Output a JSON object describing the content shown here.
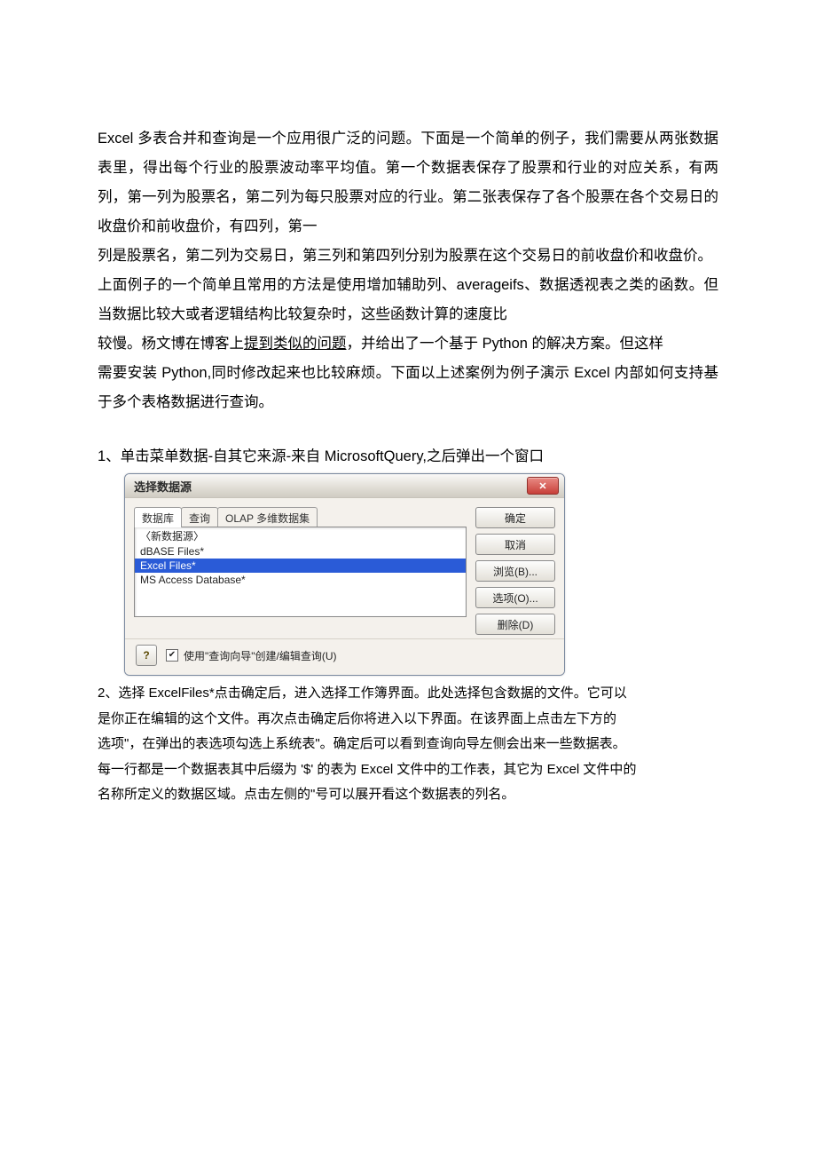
{
  "paragraphs": {
    "p1": "Excel 多表合并和查询是一个应用很广泛的问题。下面是一个简单的例子，我们需要从两张数据表里，得出每个行业的股票波动率平均值。第一个数据表保存了股票和行业的对应关系，有两列，第一列为股票名，第二列为每只股票对应的行业。第二张表保存了各个股票在各个交易日的收盘价和前收盘价，有四列，第一",
    "p2": "列是股票名，第二列为交易日，第三列和第四列分别为股票在这个交易日的前收盘价和收盘价。",
    "p3a": "上面例子的一个简单且常用的方法是使用增加辅助列、averageifs、数据透视表之类的函数。但当数据比较大或者逻辑结构比较复杂时，这些函数计算的速度比",
    "p3b_prefix": "较慢。杨文博在博客上",
    "p3b_link": "提到类似的问题",
    "p3b_suffix": "，并给出了一个基于 Python 的解决方案。但这样",
    "p3c": "需要安装 Python,同时修改起来也比较麻烦。下面以上述案例为例子演示 Excel 内部如何支持基于多个表格数据进行查询。"
  },
  "step1": "1、单击菜单数据-自其它来源-来自 MicrosoftQuery,之后弹出一个窗口",
  "dialog": {
    "title": "选择数据源",
    "close": "✕",
    "tabs": {
      "db": "数据库",
      "query": "查询",
      "olap": "OLAP 多维数据集"
    },
    "list": {
      "item0": "〈新数据源〉",
      "item1": "dBASE Files*",
      "item2": "Excel Files*",
      "item3": "MS Access Database*"
    },
    "buttons": {
      "ok": "确定",
      "cancel": "取消",
      "browse": "浏览(B)...",
      "options": "选项(O)...",
      "delete": "删除(D)"
    },
    "help": "?",
    "checkbox_mark": "✔",
    "checkbox_label": "使用\"查询向导\"创建/编辑查询(U)"
  },
  "step2": {
    "l1": "2、选择 ExcelFiles*点击确定后，进入选择工作簿界面。此处选择包含数据的文件。它可以",
    "l2": "是你正在编辑的这个文件。再次点击确定后你将进入以下界面。在该界面上点击左下方的",
    "l3": "选项\"，在弹出的表选项勾选上系统表\"。确定后可以看到查询向导左侧会出来一些数据表。",
    "l4": "每一行都是一个数据表其中后缀为 '$' 的表为 Excel 文件中的工作表，其它为 Excel 文件中的",
    "l5": "名称所定义的数据区域。点击左侧的\"号可以展开看这个数据表的列名。"
  }
}
